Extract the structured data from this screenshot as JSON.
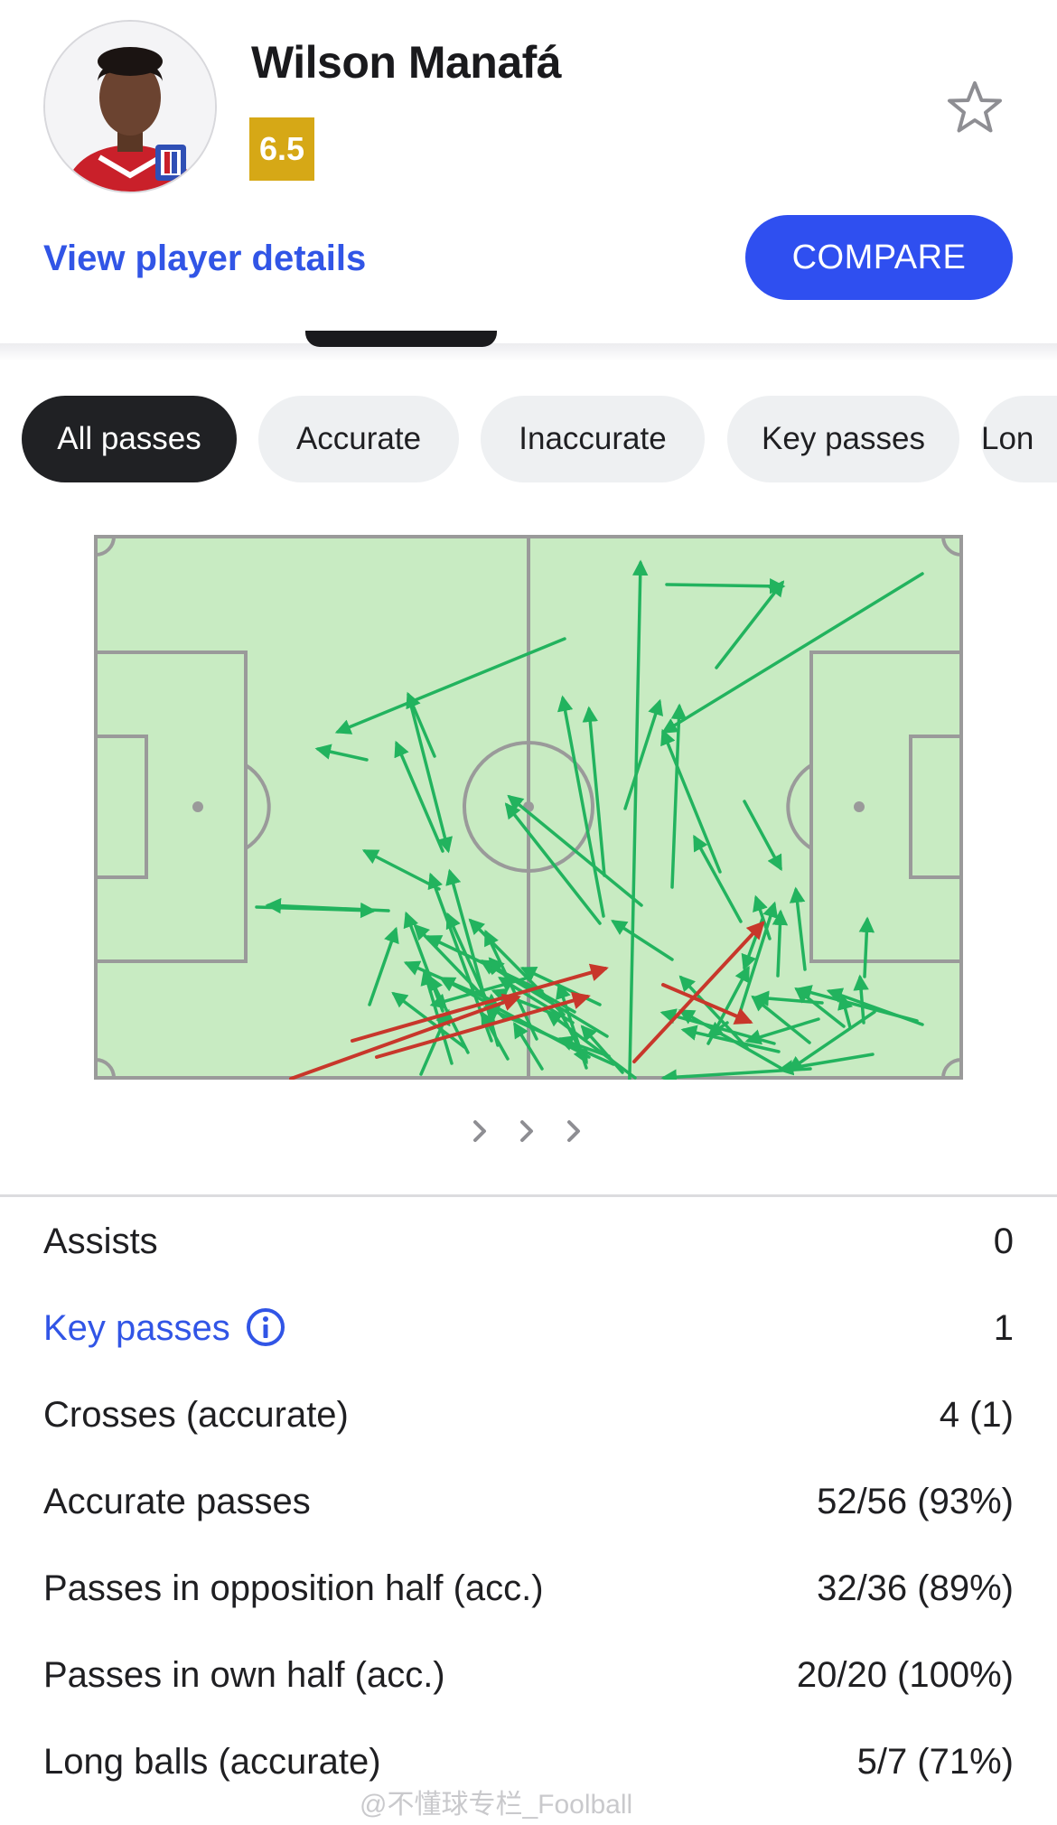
{
  "player": {
    "name": "Wilson Manafá",
    "rating": "6.5",
    "details_link": "View player details",
    "compare_label": "COMPARE",
    "favorite_icon": "star-outline-icon",
    "avatar_icon": "player-photo-icon"
  },
  "filters": [
    {
      "label": "All passes",
      "active": true
    },
    {
      "label": "Accurate",
      "active": false
    },
    {
      "label": "Inaccurate",
      "active": false
    },
    {
      "label": "Key passes",
      "active": false
    },
    {
      "label": "Lon",
      "active": false
    }
  ],
  "pitch": {
    "accurate_color": "#22b35e",
    "inaccurate_color": "#c8372b",
    "grass_color": "#c8ebc2",
    "line_color": "#9a9a9a",
    "nav_icon": "chevron-right-icon"
  },
  "stats": [
    {
      "label": "Assists",
      "value": "0"
    },
    {
      "label": "Key passes",
      "value": "1",
      "info_icon": "info-icon"
    },
    {
      "label": "Crosses (accurate)",
      "value": "4 (1)"
    },
    {
      "label": "Accurate passes",
      "value": "52/56 (93%)"
    },
    {
      "label": "Passes in opposition half (acc.)",
      "value": "32/36 (89%)"
    },
    {
      "label": "Passes in own half (acc.)",
      "value": "20/20 (100%)"
    },
    {
      "label": "Long balls (accurate)",
      "value": "5/7 (71%)"
    }
  ],
  "watermark": "@不懂球专栏_Foolball"
}
